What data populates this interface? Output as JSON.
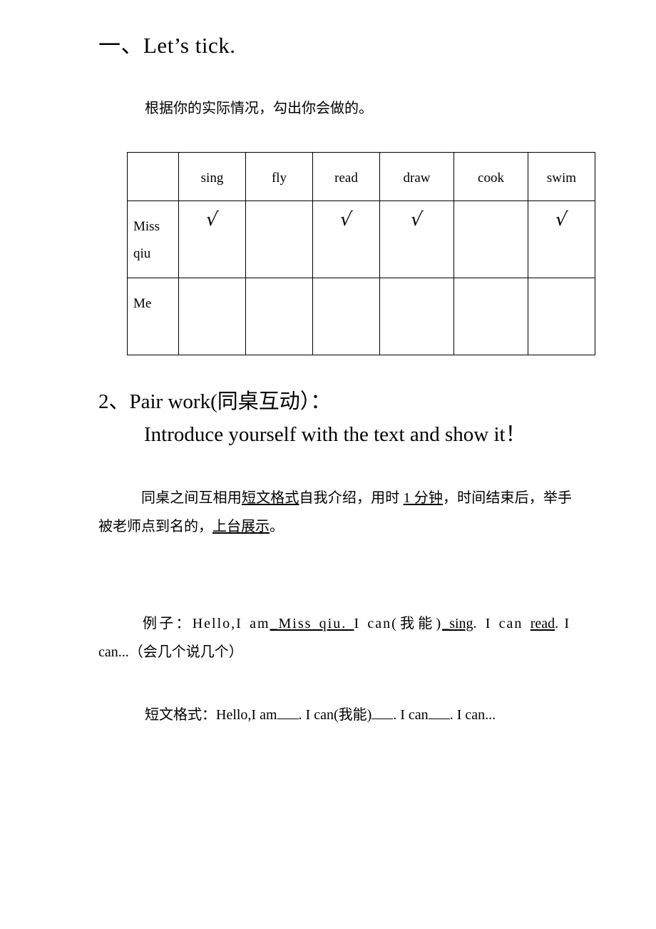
{
  "document": {
    "section1": {
      "title_prefix": "一、",
      "title_main": "Let",
      "title_apos": "’",
      "title_rest": "s tick.",
      "title_full": "一、Let’s tick.",
      "instruction": "根据你的实际情况，勾出你会做的。",
      "table": {
        "columns": [
          "",
          "sing",
          "fly",
          "read",
          "draw",
          "cook",
          "swim"
        ],
        "rows": [
          {
            "label": "Miss qiu",
            "label_line1": "Miss",
            "label_line2": "qiu",
            "marks": [
              "√",
              "",
              "√",
              "√",
              "",
              "√"
            ]
          },
          {
            "label": "Me",
            "label_line1": "Me",
            "label_line2": "",
            "marks": [
              "",
              "",
              "",
              "",
              "",
              ""
            ]
          }
        ]
      }
    },
    "section2": {
      "title": "2、Pair work(同桌互动）：",
      "subtitle": "Introduce yourself with the text and show it！",
      "body_part1": "同桌之间互相用",
      "body_underline1": "短文格式",
      "body_part2": "自我介绍，用时 ",
      "body_underline2": "1 分钟",
      "body_part3": "，时间结束后，举手被老师点到名的，",
      "body_underline3": "上台展示",
      "body_part4": "。",
      "example_label": "例子：",
      "example_part1": "Hello,I  am",
      "example_underline1": "_Miss  qiu. ",
      "example_part2": " I  can(我能)",
      "example_underline2": "_sing",
      "example_part3": ".  I  can  ",
      "example_underline3": "read",
      "example_part4": ".  I  can...（会几个说几个）",
      "format_label": "短文格式：",
      "format_part1": "Hello,I am",
      "format_part2": ". I can(我能)",
      "format_part3": ". I can",
      "format_part4": ". I can..."
    }
  }
}
